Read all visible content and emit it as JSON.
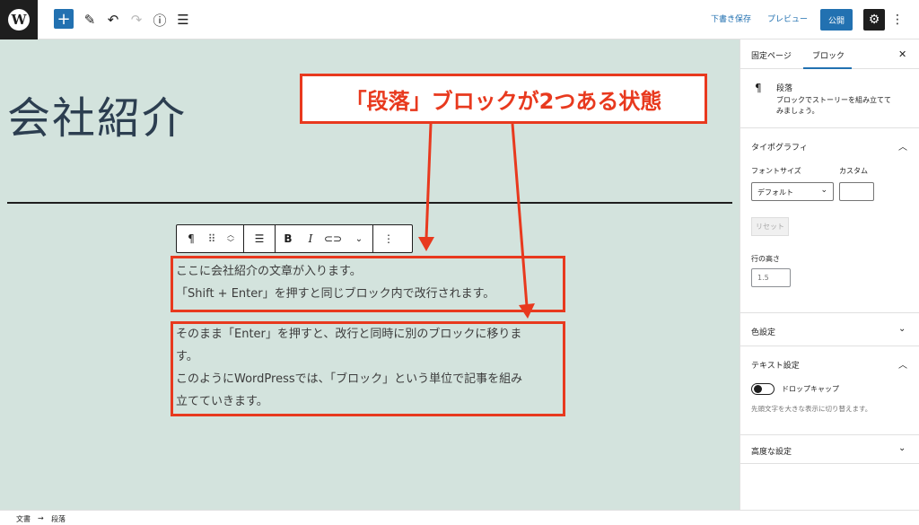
{
  "topbar": {
    "add_icon": "plus-icon",
    "tools_icon": "pencil-icon",
    "undo_icon": "undo-icon",
    "redo_icon": "redo-icon",
    "info_icon": "info-icon",
    "list_icon": "list-view-icon",
    "save_draft": "下書き保存",
    "preview": "プレビュー",
    "publish": "公開",
    "settings_icon": "gear-icon",
    "more_icon": "vertical-ellipsis-icon"
  },
  "editor": {
    "title": "会社紹介",
    "paragraphs": [
      {
        "lines": [
          "ここに会社紹介の文章が入ります。",
          "「Shift + Enter」を押すと同じブロック内で改行されます。"
        ]
      },
      {
        "lines": [
          "そのまま「Enter」を押すと、改行と同時に別のブロックに移りま",
          "す。",
          "このようにWordPressでは、「ブロック」という単位で記事を組み",
          "立てていきます。"
        ]
      }
    ],
    "block_toolbar": {
      "paragraph_glyph": "¶",
      "bold": "B",
      "italic": "I"
    }
  },
  "annotation": {
    "label": "「段落」ブロックが2つある状態",
    "color": "#e8391e"
  },
  "sidebar": {
    "tabs": [
      "固定ページ",
      "ブロック"
    ],
    "active_tab": "ブロック",
    "block_card": {
      "icon": "¶",
      "title": "段落",
      "description_lines": [
        "ブロックでストーリーを組み立てて",
        "みましょう。"
      ]
    },
    "typography": {
      "heading": "タイポグラフィ",
      "font_size_label": "フォントサイズ",
      "custom_label": "カスタム",
      "font_size_value": "デフォルト",
      "reset": "リセット",
      "line_height_label": "行の高さ",
      "line_height_value": "1.5"
    },
    "color": {
      "heading": "色設定"
    },
    "text": {
      "heading": "テキスト設定",
      "drop_cap_label": "ドロップキャップ",
      "drop_cap_help": "先頭文字を大きな表示に切り替えます。"
    },
    "advanced": {
      "heading": "高度な設定"
    }
  },
  "footer": {
    "crumbs": [
      "文書",
      "段落"
    ],
    "separator": "→"
  }
}
